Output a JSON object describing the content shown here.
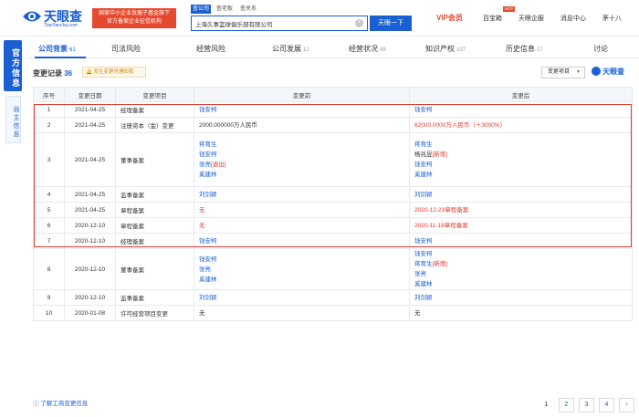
{
  "header": {
    "logo_text": "天眼查",
    "logo_sub": "TianYancha.com",
    "promo_line1": "国家中小企业发展子基金旗下",
    "promo_line2": "官方备案企业征信机构",
    "search_tabs": [
      "查公司",
      "查老板",
      "查关系"
    ],
    "search_value": "上海久事篮球俱乐部有限公司",
    "search_button": "天眼一下",
    "vip_label": "VIP会员",
    "nav": [
      "百宝箱",
      "天眼企服",
      "消息中心"
    ],
    "hot_badge": "HOT",
    "user": "茅十八"
  },
  "side": {
    "official": "官方信息",
    "self": "自主信息"
  },
  "tabs": [
    {
      "label": "公司背景",
      "count": "61"
    },
    {
      "label": "司法风险",
      "count": ""
    },
    {
      "label": "经营风险",
      "count": ""
    },
    {
      "label": "公司发展",
      "count": "12"
    },
    {
      "label": "经营状况",
      "count": "49"
    },
    {
      "label": "知识产权",
      "count": "107"
    },
    {
      "label": "历史信息",
      "count": "17"
    },
    {
      "label": "讨论",
      "count": ""
    }
  ],
  "section": {
    "title": "变更记录",
    "count": "36",
    "watch_label": "发生变更时通知我",
    "filter_label": "变更项目",
    "brand": "天眼查"
  },
  "table": {
    "headers": [
      "序号",
      "变更日期",
      "变更项目",
      "变更前",
      "变更后"
    ],
    "rows": [
      {
        "no": "1",
        "date": "2021-04-25",
        "item": "经理备案",
        "before": [
          {
            "t": "钱安柯",
            "c": "b"
          }
        ],
        "after": [
          {
            "t": "钱安柯",
            "c": "b"
          }
        ]
      },
      {
        "no": "2",
        "date": "2021-04-25",
        "item": "注册资本（金）变更",
        "before": [
          {
            "t": "2000.000000万人民币",
            "c": ""
          }
        ],
        "after": [
          {
            "t": "62000.0000万人民币（＋3000%）",
            "c": "r"
          }
        ]
      },
      {
        "no": "3",
        "date": "2021-04-25",
        "item": "董事备案",
        "before": [
          {
            "t": "蒋育生",
            "c": "b"
          },
          {
            "t": "钱安柯",
            "c": "b"
          },
          {
            "t": "张亮",
            "c": "b",
            "tag": "[退出]"
          },
          {
            "t": "奚建林",
            "c": "b"
          }
        ],
        "after": [
          {
            "t": "蒋育生",
            "c": "b"
          },
          {
            "t": "杨兆昱",
            "c": "",
            "tag": "[新增]"
          },
          {
            "t": "钱安柯",
            "c": "b"
          },
          {
            "t": "奚建林",
            "c": "b"
          }
        ]
      },
      {
        "no": "4",
        "date": "2021-04-25",
        "item": "监事备案",
        "before": [
          {
            "t": "刘剑颖",
            "c": "b"
          }
        ],
        "after": [
          {
            "t": "刘剑颖",
            "c": "b"
          }
        ]
      },
      {
        "no": "5",
        "date": "2021-04-25",
        "item": "章程备案",
        "before": [
          {
            "t": "无",
            "c": "r"
          }
        ],
        "after": [
          {
            "t": "2020-12-23章程备案",
            "c": "r"
          }
        ]
      },
      {
        "no": "6",
        "date": "2020-12-10",
        "item": "章程备案",
        "before": [
          {
            "t": "无",
            "c": "r"
          }
        ],
        "after": [
          {
            "t": "2020-11-18章程备案",
            "c": "r"
          }
        ]
      },
      {
        "no": "7",
        "date": "2020-12-10",
        "item": "经理备案",
        "before": [
          {
            "t": "钱安柯",
            "c": "b"
          }
        ],
        "after": [
          {
            "t": "钱安柯",
            "c": "b"
          }
        ]
      },
      {
        "no": "8",
        "date": "2020-12-10",
        "item": "董事备案",
        "before": [
          {
            "t": "钱安柯",
            "c": "b"
          },
          {
            "t": "张亮",
            "c": "b"
          },
          {
            "t": "奚建林",
            "c": "b"
          }
        ],
        "after": [
          {
            "t": "钱安柯",
            "c": "b"
          },
          {
            "t": "蒋育生",
            "c": "b",
            "tag": "[新增]"
          },
          {
            "t": "张亮",
            "c": "b"
          },
          {
            "t": "奚建林",
            "c": "b"
          }
        ]
      },
      {
        "no": "9",
        "date": "2020-12-10",
        "item": "监事备案",
        "before": [
          {
            "t": "刘剑颖",
            "c": "b"
          }
        ],
        "after": [
          {
            "t": "刘剑颖",
            "c": "b"
          }
        ]
      },
      {
        "no": "10",
        "date": "2020-01-08",
        "item": "许可经营项目变更",
        "before": [
          {
            "t": "无",
            "c": ""
          }
        ],
        "after": [
          {
            "t": "无",
            "c": ""
          }
        ]
      }
    ]
  },
  "footer": {
    "help_link": "了解工商变更信息",
    "pages": [
      "1",
      "2",
      "3",
      "4"
    ],
    "next": "›"
  },
  "colors": {
    "brand": "#1a5fd4",
    "highlight": "#e23b2e"
  }
}
